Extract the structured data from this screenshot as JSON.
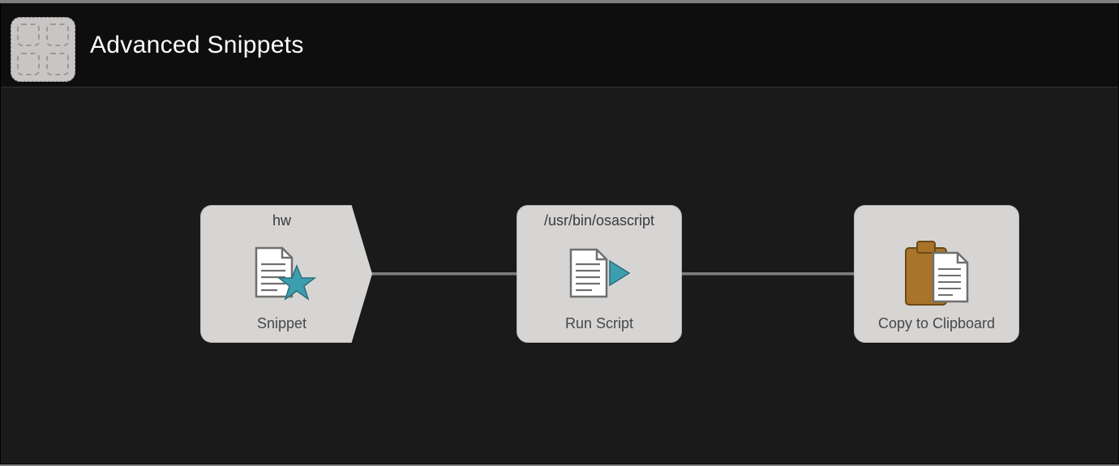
{
  "header": {
    "title": "Advanced Snippets"
  },
  "nodes": {
    "trigger": {
      "title": "hw",
      "label": "Snippet"
    },
    "runscript": {
      "title": "/usr/bin/osascript",
      "label": "Run Script"
    },
    "clipboard": {
      "title": "",
      "label": "Copy to Clipboard"
    }
  }
}
